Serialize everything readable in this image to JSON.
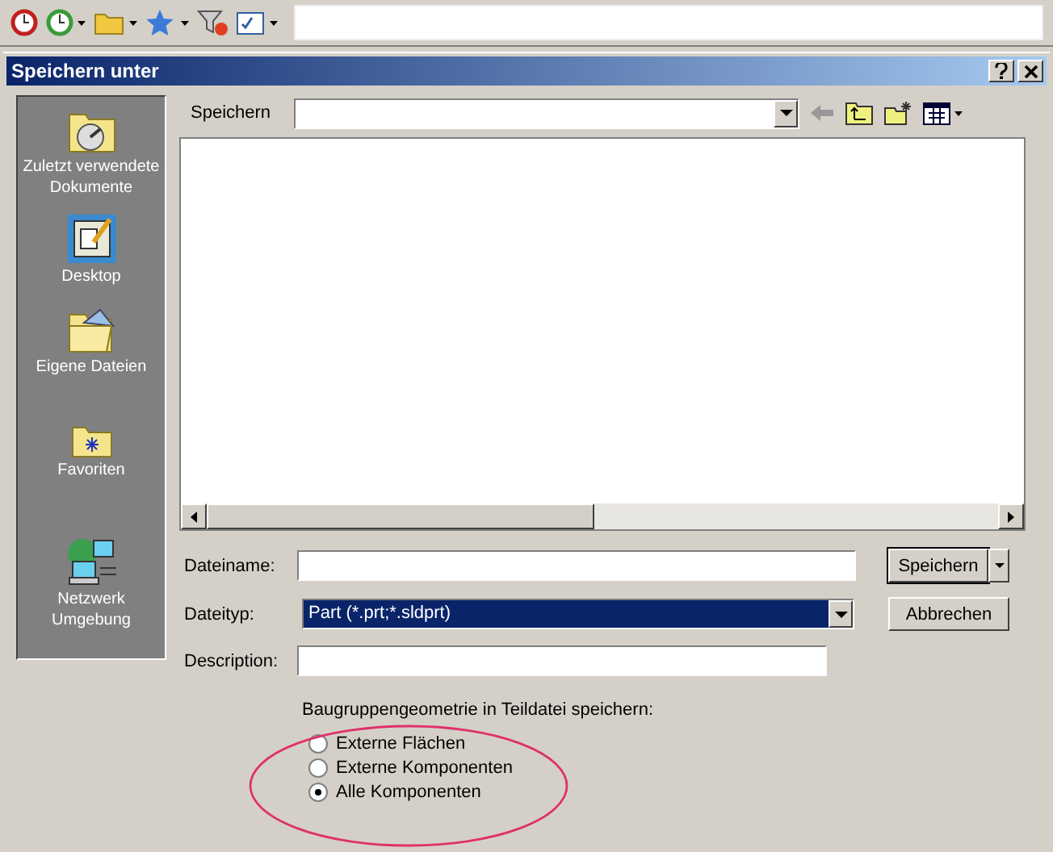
{
  "dialog": {
    "title": "Speichern unter"
  },
  "places": [
    {
      "label": "Zuletzt verwendete Dokumente",
      "kind": "recent"
    },
    {
      "label": "Desktop",
      "kind": "desktop"
    },
    {
      "label": "Eigene Dateien",
      "kind": "documents"
    },
    {
      "label": "Favoriten",
      "kind": "favorites"
    },
    {
      "label": "Netzwerk Umgebung",
      "kind": "network"
    }
  ],
  "save_in": {
    "label": "Speichern"
  },
  "filename": {
    "label": "Dateiname:"
  },
  "filetype": {
    "label": "Dateityp:",
    "value": "Part (*.prt;*.sldprt)"
  },
  "description": {
    "label": "Description:"
  },
  "buttons": [
    {
      "label": "Speichern",
      "kind": "split"
    },
    {
      "label": "Abbrechen",
      "kind": "plain"
    }
  ],
  "geometry": {
    "label": "Baugruppengeometrie in Teildatei speichern:",
    "options": [
      {
        "label": "Externe Flächen",
        "selected": false
      },
      {
        "label": "Externe Komponenten",
        "selected": false
      },
      {
        "label": "Alle Komponenten",
        "selected": true
      }
    ]
  }
}
